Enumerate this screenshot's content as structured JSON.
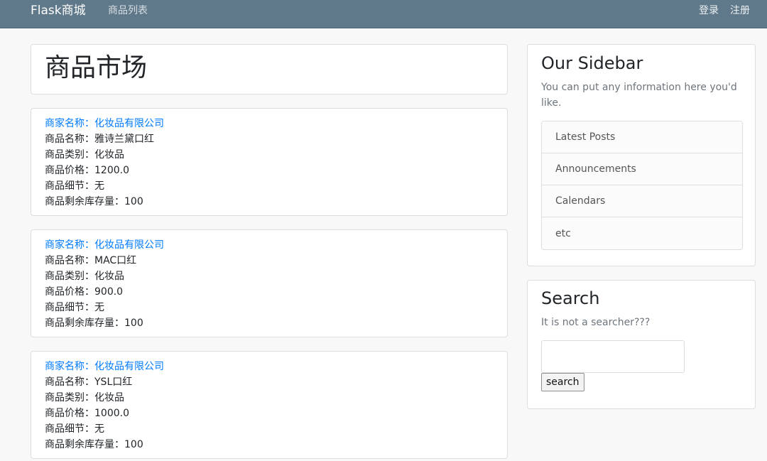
{
  "navbar": {
    "brand": "Flask商城",
    "links": {
      "products": "商品列表",
      "login": "登录",
      "register": "注册"
    },
    "background_color": "#5f788a"
  },
  "main": {
    "title": "商品市场",
    "products": [
      {
        "merchant": "商家名称：化妆品有限公司",
        "name": "商品名称：雅诗兰黛口红",
        "category": "商品类别：化妆品",
        "price": "商品价格：1200.0",
        "detail": "商品细节：无",
        "stock": "商品剩余库存量：100"
      },
      {
        "merchant": "商家名称：化妆品有限公司",
        "name": "商品名称：MAC口红",
        "category": "商品类别：化妆品",
        "price": "商品价格：900.0",
        "detail": "商品细节：无",
        "stock": "商品剩余库存量：100"
      },
      {
        "merchant": "商家名称：化妆品有限公司",
        "name": "商品名称：YSL口红",
        "category": "商品类别：化妆品",
        "price": "商品价格：1000.0",
        "detail": "商品细节：无",
        "stock": "商品剩余库存量：100"
      }
    ],
    "link_color": "#007bff"
  },
  "sidebar": {
    "title": "Our Sidebar",
    "description": "You can put any information here you'd like.",
    "items": [
      {
        "label": "Latest Posts"
      },
      {
        "label": "Announcements"
      },
      {
        "label": "Calendars"
      },
      {
        "label": "etc"
      }
    ]
  },
  "search": {
    "title": "Search",
    "description": "It is not a searcher???",
    "input_value": "",
    "button_label": "search"
  }
}
